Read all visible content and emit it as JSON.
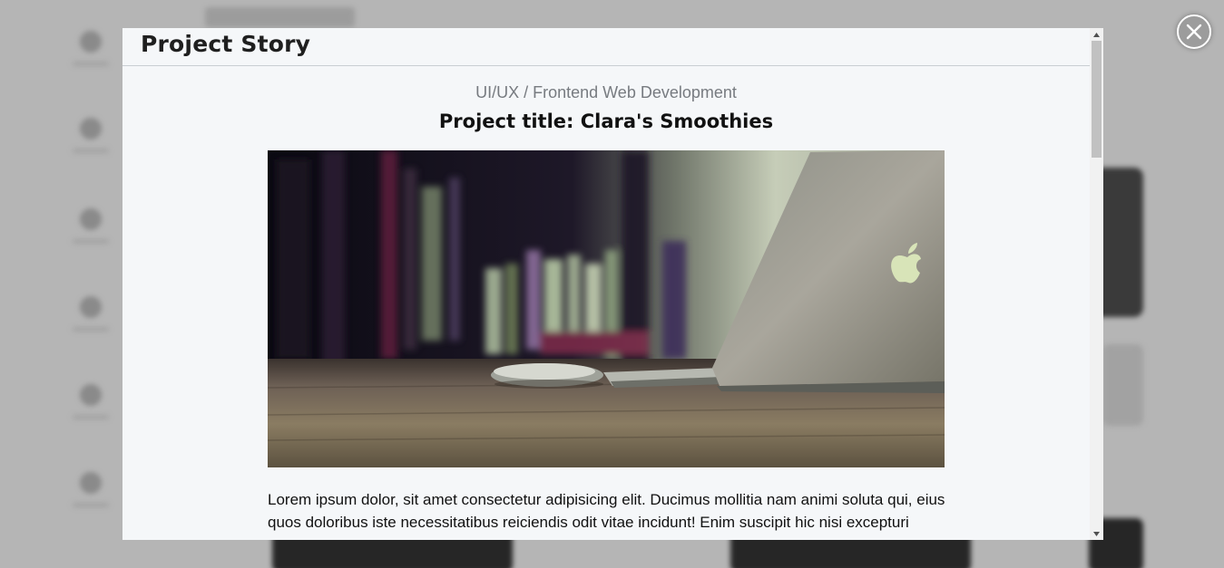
{
  "modal": {
    "title": "Project Story",
    "category": "UI/UX / Frontend Web Development",
    "project_title": "Project title: Clara's Smoothies",
    "image_alt": "laptop and mouse on a wooden desk",
    "description": "Lorem ipsum dolor, sit amet consectetur adipisicing elit. Ducimus mollitia nam animi soluta qui, eius quos doloribus iste necessitatibus reiciendis odit vitae incidunt! Enim suscipit hic nisi excepturi"
  },
  "icons": {
    "close": "close-icon",
    "scroll_up": "scroll-up-arrow-icon",
    "scroll_down": "scroll-down-arrow-icon"
  },
  "colors": {
    "overlay": "#b5b5b5",
    "modal_bg": "#f5f7f9",
    "title_text": "#1f1f1f",
    "category_text": "#777b80"
  }
}
